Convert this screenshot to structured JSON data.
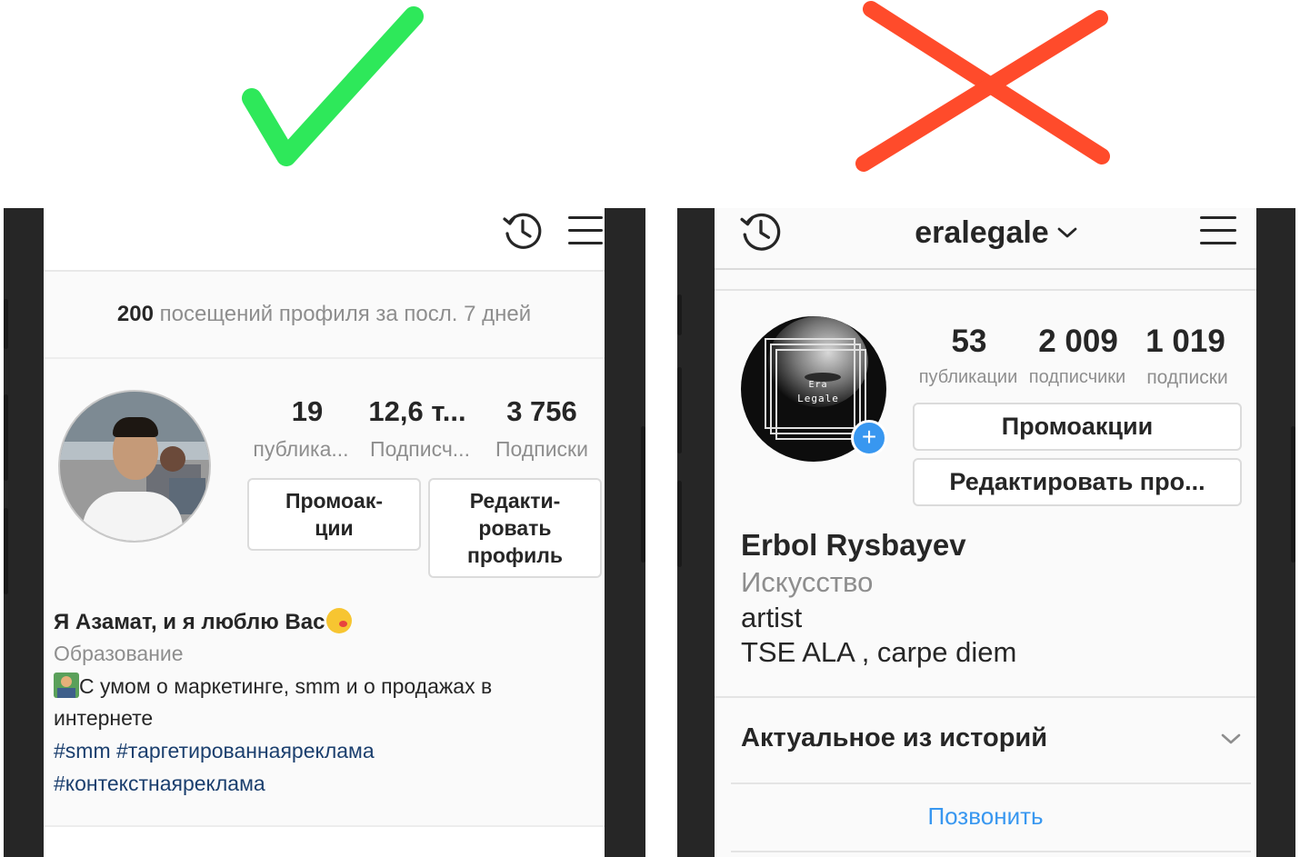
{
  "left": {
    "marker": "check",
    "insights": {
      "count": "200",
      "text": "посещений профиля за посл. 7 дней"
    },
    "stats": [
      {
        "value": "19",
        "label": "публика..."
      },
      {
        "value": "12,6 т...",
        "label": "Подписч..."
      },
      {
        "value": "3 756",
        "label": "Подписки"
      }
    ],
    "buttons": {
      "promo_line1": "Промоак-",
      "promo_line2": "ции",
      "edit_line1": "Редакти-",
      "edit_line2": "ровать",
      "edit_line3": "профиль"
    },
    "bio": {
      "name": "Я Азамат, и я люблю Вас",
      "category": "Образование",
      "line1": "С умом о маркетинге, smm и о продажах в",
      "line2": "интернете",
      "tags1": "#smm #таргетированнаяреклама",
      "tags2": "#контекстнаяреклама"
    }
  },
  "right": {
    "marker": "cross",
    "username": "eralegale",
    "avatar_text_1": "Era",
    "avatar_text_2": "Legale",
    "stats": [
      {
        "value": "53",
        "label": "публикации"
      },
      {
        "value": "2 009",
        "label": "подписчики"
      },
      {
        "value": "1 019",
        "label": "подписки"
      }
    ],
    "buttons": {
      "promo": "Промоакции",
      "edit": "Редактировать про..."
    },
    "bio": {
      "name": "Erbol Rysbayev",
      "category": "Искусство",
      "line1": "artist",
      "line2": "TSE ALA , carpe diem"
    },
    "highlights": "Актуальное из историй",
    "call": "Позвонить"
  },
  "colors": {
    "check": "#2ee85a",
    "cross": "#ff4b2b",
    "link": "#3897f0",
    "hashtag": "#1b3f6e"
  }
}
